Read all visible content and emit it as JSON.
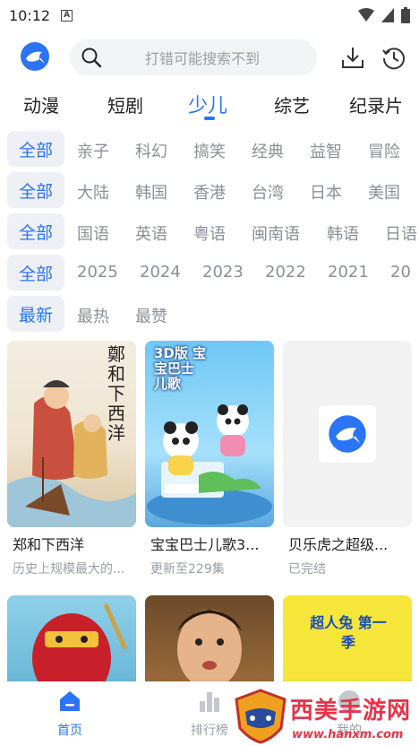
{
  "status": {
    "time": "10:12"
  },
  "search": {
    "placeholder": "打错可能搜索不到"
  },
  "tabs": [
    "动漫",
    "短剧",
    "少儿",
    "综艺",
    "纪录片"
  ],
  "active_tab": "少儿",
  "filters": {
    "row1": {
      "all": "全部",
      "options": [
        "亲子",
        "科幻",
        "搞笑",
        "经典",
        "益智",
        "冒险"
      ]
    },
    "row2": {
      "all": "全部",
      "options": [
        "大陆",
        "韩国",
        "香港",
        "台湾",
        "日本",
        "美国"
      ]
    },
    "row3": {
      "all": "全部",
      "options": [
        "国语",
        "英语",
        "粤语",
        "闽南语",
        "韩语",
        "日语"
      ]
    },
    "row4": {
      "all": "全部",
      "options": [
        "2025",
        "2024",
        "2023",
        "2022",
        "2021",
        "20"
      ]
    },
    "row5": {
      "all": "最新",
      "options": [
        "最热",
        "最赞"
      ]
    }
  },
  "cards": [
    {
      "title": "郑和下西洋",
      "subtitle": "历史上规模最大的...",
      "poster_text": "鄭和下西洋"
    },
    {
      "title": "宝宝巴士儿歌3...",
      "subtitle": "更新至229集",
      "poster_text": "3D版 宝宝巴士 儿歌"
    },
    {
      "title": "贝乐虎之超级...",
      "subtitle": "已完结",
      "poster_text": ""
    },
    {
      "title": "",
      "subtitle": "",
      "poster_text": ""
    },
    {
      "title": "",
      "subtitle": "",
      "poster_text": ""
    },
    {
      "title": "",
      "subtitle": "",
      "poster_text": "超人兔 第一季"
    }
  ],
  "nav": {
    "home": "首页",
    "rank": "排行榜",
    "mine": "我的"
  },
  "watermark": {
    "name": "西美手游网",
    "url": "www.hanxm.com"
  },
  "colors": {
    "accent": "#2a74f5",
    "muted": "#8c8f96",
    "chip_bg": "#eef0f5",
    "watermark": "#e8334a"
  }
}
